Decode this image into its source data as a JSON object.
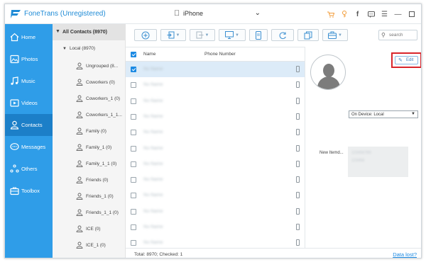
{
  "app": {
    "title": "FoneTrans (Unregistered)"
  },
  "device": {
    "name": "iPhone"
  },
  "titlebar_icons": [
    "cart-icon",
    "key-icon",
    "facebook-icon",
    "chat-icon",
    "menu-icon",
    "minimize-icon",
    "maximize-icon",
    "close-icon"
  ],
  "sidebar": {
    "items": [
      {
        "label": "Home",
        "icon": "home-icon"
      },
      {
        "label": "Photos",
        "icon": "photos-icon"
      },
      {
        "label": "Music",
        "icon": "music-icon"
      },
      {
        "label": "Videos",
        "icon": "videos-icon"
      },
      {
        "label": "Contacts",
        "icon": "contacts-icon",
        "active": true
      },
      {
        "label": "Messages",
        "icon": "messages-icon"
      },
      {
        "label": "Others",
        "icon": "others-icon"
      },
      {
        "label": "Toolbox",
        "icon": "toolbox-icon"
      }
    ]
  },
  "tree": {
    "header": "All Contacts (8970)",
    "local": "Local (8970)",
    "groups": [
      "Ungrouped (8...",
      "Coworkers (0)",
      "Coworkers_1 (0)",
      "Coworkers_1_1...",
      "Family (0)",
      "Family_1 (0)",
      "Family_1_1 (0)",
      "Friends (0)",
      "Friends_1 (0)",
      "Friends_1_1 (0)",
      "ICE (0)",
      "ICE_1 (0)"
    ]
  },
  "toolbar": {
    "buttons": [
      "add-contact",
      "import",
      "export",
      "export-to-pc",
      "backup",
      "refresh",
      "duplicate",
      "toolbox"
    ],
    "search_placeholder": "search"
  },
  "table": {
    "columns": {
      "name": "Name",
      "phone": "Phone Number"
    },
    "rows": [
      {
        "name": "No Name",
        "checked": true,
        "selected": true
      },
      {
        "name": "No Name",
        "checked": false
      },
      {
        "name": "No Name",
        "checked": false
      },
      {
        "name": "No Name",
        "checked": false
      },
      {
        "name": "No Name",
        "checked": false
      },
      {
        "name": "No Name",
        "checked": false
      },
      {
        "name": "No Name",
        "checked": false
      },
      {
        "name": "No Name",
        "checked": false
      },
      {
        "name": "No Name",
        "checked": false
      },
      {
        "name": "No Name",
        "checked": false
      },
      {
        "name": "No Name",
        "checked": false
      },
      {
        "name": "No Name",
        "checked": false
      },
      {
        "name": "No Name",
        "checked": false
      }
    ]
  },
  "detail": {
    "edit_label": "Edit",
    "on_device": "On Device: Local",
    "field_label": "New Itemd...",
    "field_value_1": "123456789",
    "field_value_2": "123456"
  },
  "footer": {
    "total": "Total: 8970; Checked: 1",
    "data_lost": "Data lost?"
  },
  "colors": {
    "sidebar": "#2f9de8",
    "sidebar_active": "#1c7fc8",
    "accent": "#1c8ae3",
    "highlight_box": "#d9252b",
    "title": "#1f8bd6"
  }
}
